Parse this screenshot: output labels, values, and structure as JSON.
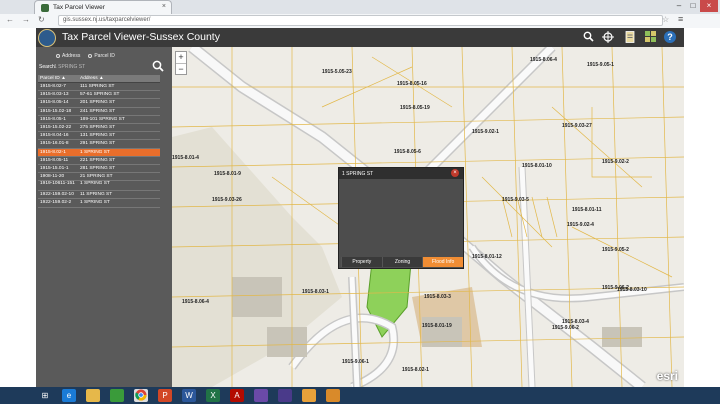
{
  "browser": {
    "tab_title": "Tax Parcel Viewer",
    "tab_close": "×",
    "url": "gis.sussex.nj.us/taxparcelviewer/",
    "nav_back": "←",
    "nav_fwd": "→",
    "nav_reload": "↻",
    "star": "☆",
    "menu": "≡"
  },
  "app": {
    "title": "Tax Parcel Viewer-Sussex County",
    "icons": [
      "search-icon",
      "locate-icon",
      "document-icon",
      "basemap-icon",
      "help-icon"
    ]
  },
  "sidebar": {
    "tab_address": "Address",
    "tab_parcel": "Parcel ID",
    "search_label": "Search",
    "search_value": "1 SPRING ST",
    "col_parcel": "Parcel ID",
    "col_address": "Address",
    "rows": [
      {
        "id": "1915-8.02-7",
        "addr": "111 SPRING ST"
      },
      {
        "id": "1915-8.03-13",
        "addr": "57-61 SPRING ST"
      },
      {
        "id": "1915-8.05-14",
        "addr": "201 SPRING ST"
      },
      {
        "id": "1915-15.02-18",
        "addr": "241 SPRING ST"
      },
      {
        "id": "1915-8.05-1",
        "addr": "189-101 SPRING ST"
      },
      {
        "id": "1915-15.02-22",
        "addr": "275 SPRING ST"
      },
      {
        "id": "1915-8.04-16",
        "addr": "131 SPRING ST"
      },
      {
        "id": "1915-16.01-8",
        "addr": "291 SPRING ST"
      },
      {
        "id": "1915-8.02-1",
        "addr": "1 SPRING ST",
        "selected": true
      },
      {
        "id": "1915-8.05-11",
        "addr": "221 SPRING ST"
      },
      {
        "id": "1915-15.01-1",
        "addr": "281 SPRING ST"
      },
      {
        "id": "1908-11-20",
        "addr": "21 SPRING ST"
      },
      {
        "id": "1919-10611-151",
        "addr": "1 SPRING ST",
        "double": true
      },
      {
        "id": "1922-159.02-10",
        "addr": "11 SPRING ST"
      },
      {
        "id": "1922-159.02-2",
        "addr": "1 SPRING ST"
      }
    ]
  },
  "map": {
    "zoom_in": "+",
    "zoom_out": "−",
    "attribution": "esri",
    "labels": [
      "1915-5.05-23",
      "1915-8.06-4",
      "1915-9.05-1",
      "1915-8.05-16",
      "1915-8.05-19",
      "1915-9.03-27",
      "1915-9.02-1",
      "1915-8.01-4",
      "1915-8.01-9",
      "1915-8.05-6",
      "1915-8.01-10",
      "1915-9.02-2",
      "1915-9.03-26",
      "1915-9.03-5",
      "1915-8.01-11",
      "1915-9.02-4",
      "1915-9.01-14",
      "1915-9.05-2",
      "1915-8.01-12",
      "1915-8.03-1",
      "1915-8.03-3",
      "1915-9.06-2",
      "1915-8.06-4",
      "1915-8.01-19",
      "1915-8.03-4",
      "1915-9.06-1",
      "1915-8.02-1",
      "1915-8.03-10",
      "1915-9.06-2"
    ]
  },
  "popup": {
    "title": "1 SPRING ST",
    "close": "×",
    "tab_property": "Property",
    "tab_zoning": "Zoning",
    "tab_flood": "Flood Info"
  },
  "taskbar": {
    "start": "⊞",
    "apps": [
      "ie",
      "explorer",
      "store",
      "chrome",
      "powerpoint",
      "word",
      "excel",
      "acrobat",
      "app1",
      "app2",
      "app3",
      "app4",
      "app5"
    ]
  }
}
